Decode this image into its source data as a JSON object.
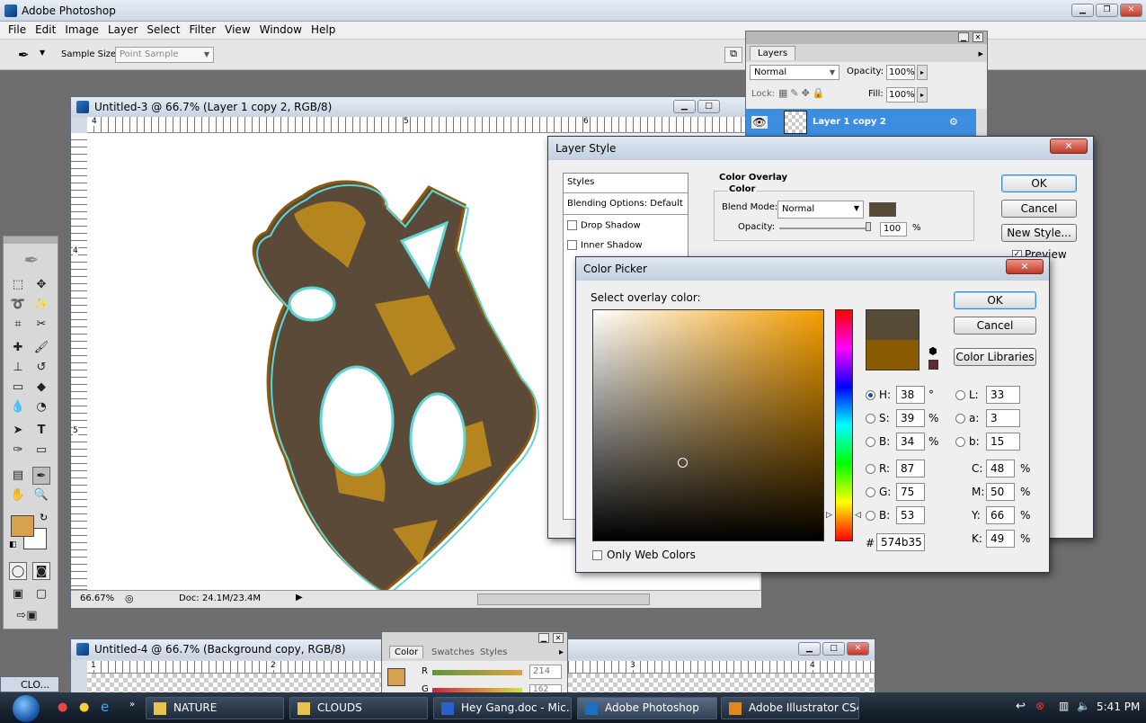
{
  "app": {
    "title": "Adobe Photoshop"
  },
  "menu": [
    "File",
    "Edit",
    "Image",
    "Layer",
    "Select",
    "Filter",
    "View",
    "Window",
    "Help"
  ],
  "options": {
    "sample_size_label": "Sample Size:",
    "sample_size_value": "Point Sample"
  },
  "document1": {
    "title": "Untitled-3 @ 66.7% (Layer 1 copy 2, RGB/8)",
    "ruler_top": [
      "4",
      "5",
      "6"
    ],
    "ruler_left": [
      "4",
      "5"
    ],
    "zoom": "66.67%",
    "doc_info": "Doc: 24.1M/23.4M"
  },
  "document2": {
    "title": "Untitled-4 @ 66.7% (Background copy, RGB/8)",
    "ruler_top": [
      "1",
      "2",
      "3",
      "4"
    ]
  },
  "layers": {
    "tab": "Layers",
    "blend": "Normal",
    "opacity_label": "Opacity:",
    "opacity": "100%",
    "lock_label": "Lock:",
    "fill_label": "Fill:",
    "fill": "100%",
    "layer_name": "Layer 1 copy 2"
  },
  "layer_style": {
    "title": "Layer Style",
    "styles_header": "Styles",
    "blending": "Blending Options: Default",
    "items": [
      "Drop Shadow",
      "Inner Shadow"
    ],
    "section": "Color Overlay",
    "subsection": "Color",
    "blend_mode_label": "Blend Mode:",
    "blend_mode": "Normal",
    "opacity_label": "Opacity:",
    "opacity": "100",
    "pct": "%",
    "ok": "OK",
    "cancel": "Cancel",
    "new_style": "New Style...",
    "preview": "Preview",
    "swatch_color": "#574b35"
  },
  "color_picker": {
    "title": "Color Picker",
    "prompt": "Select overlay color:",
    "ok": "OK",
    "cancel": "Cancel",
    "libraries": "Color Libraries",
    "new_color": "#574b35",
    "current_color": "#8a5a00",
    "fields": {
      "H": "38",
      "S": "39",
      "B": "34",
      "R": "87",
      "G": "75",
      "Bl": "53",
      "L": "33",
      "a": "3",
      "b": "15",
      "C": "48",
      "M": "50",
      "Y": "66",
      "K": "49",
      "hex": "574b35"
    },
    "units": {
      "deg": "°",
      "pct": "%"
    },
    "labels": {
      "H": "H:",
      "S": "S:",
      "B": "B:",
      "R": "R:",
      "G": "G:",
      "Bl": "B:",
      "L": "L:",
      "a": "a:",
      "b": "b:",
      "C": "C:",
      "M": "M:",
      "Y": "Y:",
      "K": "K:",
      "hex": "#"
    },
    "web_only": "Only Web Colors"
  },
  "color_panel": {
    "tabs": [
      "Color",
      "Swatches",
      "Styles"
    ],
    "R_label": "R",
    "R": "214",
    "G_label": "G",
    "G": "162",
    "fg": "#d6a24f"
  },
  "toolbox": {
    "fg": "#d6a24f",
    "bg": "#ffffff"
  },
  "leftover": {
    "text": "CLO..."
  },
  "taskbar": {
    "items": [
      "NATURE",
      "CLOUDS",
      "Hey Gang.doc - Mic...",
      "Adobe Photoshop",
      "Adobe Illustrator CS4"
    ],
    "time": "5:41 PM"
  }
}
